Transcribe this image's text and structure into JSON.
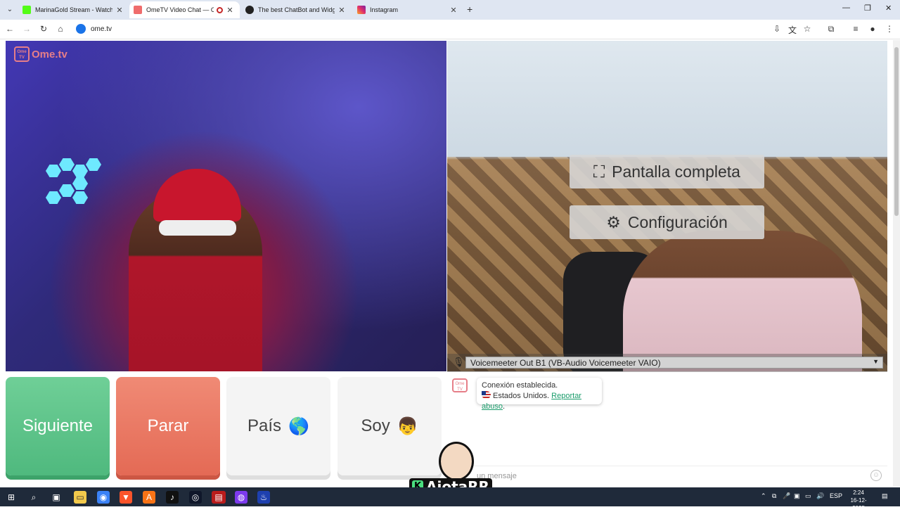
{
  "browser": {
    "tabs": [
      {
        "title": "MarinaGold Stream - Watch Live",
        "favicon_color": "#53fc18",
        "active": false
      },
      {
        "title": "OmeTV Video Chat — Omegle",
        "favicon_color": "#ef6c6c",
        "active": true
      },
      {
        "title": "The best ChatBot and Widgets",
        "favicon_color": "#222222",
        "active": false
      },
      {
        "title": "Instagram",
        "favicon_color": "#e1306c",
        "active": false
      }
    ],
    "new_tab": "+",
    "url": "ome.tv"
  },
  "app": {
    "brand": "Ome.tv",
    "brand_badge": "Ome TV",
    "overlay": {
      "fullscreen": "Pantalla completa",
      "settings": "Configuración"
    },
    "audio_device": "Voicemeeter Out B1 (VB-Audio Voicemeeter VAIO)",
    "buttons": {
      "next": "Siguiente",
      "stop": "Parar",
      "country": "País",
      "country_emoji": "🌎",
      "me": "Soy",
      "me_emoji": "👦"
    },
    "chat": {
      "status": "Conexión establecida.",
      "country": "Estados Unidos.",
      "report": "Reportar abuso",
      "placeholder": "un mensaje"
    }
  },
  "streamer_overlay": {
    "name": "AjotaRR",
    "badge": "K"
  },
  "taskbar": {
    "language": "ESP",
    "time": "2:24",
    "date": "16-12-2025"
  },
  "colors": {
    "next": "#5ec28a",
    "stop": "#ea7660",
    "brand": "#e67e88"
  }
}
